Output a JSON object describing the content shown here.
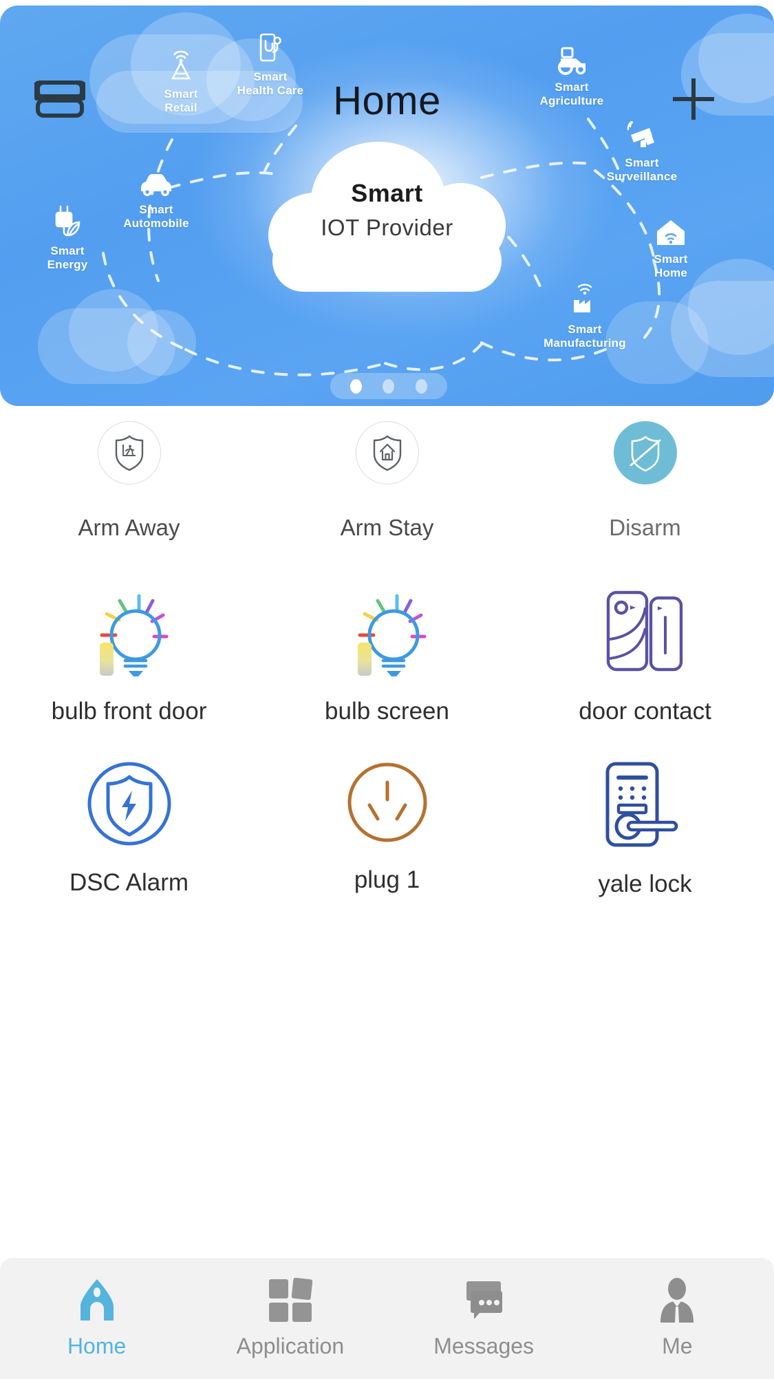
{
  "header": {
    "title": "Home",
    "menu_icon": "split-panel-icon",
    "add_icon": "plus-icon"
  },
  "banner": {
    "hero_line1": "Smart",
    "hero_line2": "IOT Provider",
    "categories": [
      {
        "label": "Smart\nRetail",
        "icon": "retail-antenna-icon"
      },
      {
        "label": "Smart\nHealth Care",
        "icon": "health-phone-stethoscope-icon"
      },
      {
        "label": "Smart\nAutomobile",
        "icon": "car-icon"
      },
      {
        "label": "Smart\nEnergy",
        "icon": "plug-leaf-icon"
      },
      {
        "label": "Smart\nAgriculture",
        "icon": "tractor-icon"
      },
      {
        "label": "Smart\nSurveillance",
        "icon": "cctv-camera-icon"
      },
      {
        "label": "Smart\nHome",
        "icon": "house-wifi-icon"
      },
      {
        "label": "Smart\nManufacturing",
        "icon": "factory-wifi-icon"
      }
    ],
    "pager": {
      "total": 3,
      "active_index": 0
    }
  },
  "security": {
    "modes": [
      {
        "label": "Arm Away",
        "icon": "shield-walking-person-icon",
        "active": false
      },
      {
        "label": "Arm Stay",
        "icon": "shield-house-icon",
        "active": false
      },
      {
        "label": "Disarm",
        "icon": "shield-slash-icon",
        "active": true
      }
    ],
    "active_color": "#6fbcd6"
  },
  "devices": [
    {
      "label": "bulb front door",
      "icon": "light-bulb-icon",
      "color": "#3d9ae0"
    },
    {
      "label": "bulb screen",
      "icon": "light-bulb-icon",
      "color": "#3d9ae0"
    },
    {
      "label": "door contact",
      "icon": "door-contact-sensor-icon",
      "color": "#5b52a3"
    },
    {
      "label": "DSC Alarm",
      "icon": "shield-bolt-circle-icon",
      "color": "#3572d6"
    },
    {
      "label": "plug 1",
      "icon": "power-socket-icon",
      "color": "#b5712f"
    },
    {
      "label": "yale lock",
      "icon": "keypad-door-lock-icon",
      "color": "#2f4f9e"
    }
  ],
  "tabbar": {
    "items": [
      {
        "label": "Home",
        "icon": "house-icon",
        "active": true
      },
      {
        "label": "Application",
        "icon": "grid-squares-icon",
        "active": false
      },
      {
        "label": "Messages",
        "icon": "chat-bubbles-icon",
        "active": false
      },
      {
        "label": "Me",
        "icon": "person-avatar-icon",
        "active": false
      }
    ],
    "active_color": "#55b4de",
    "inactive_color": "#8e8e8e"
  }
}
